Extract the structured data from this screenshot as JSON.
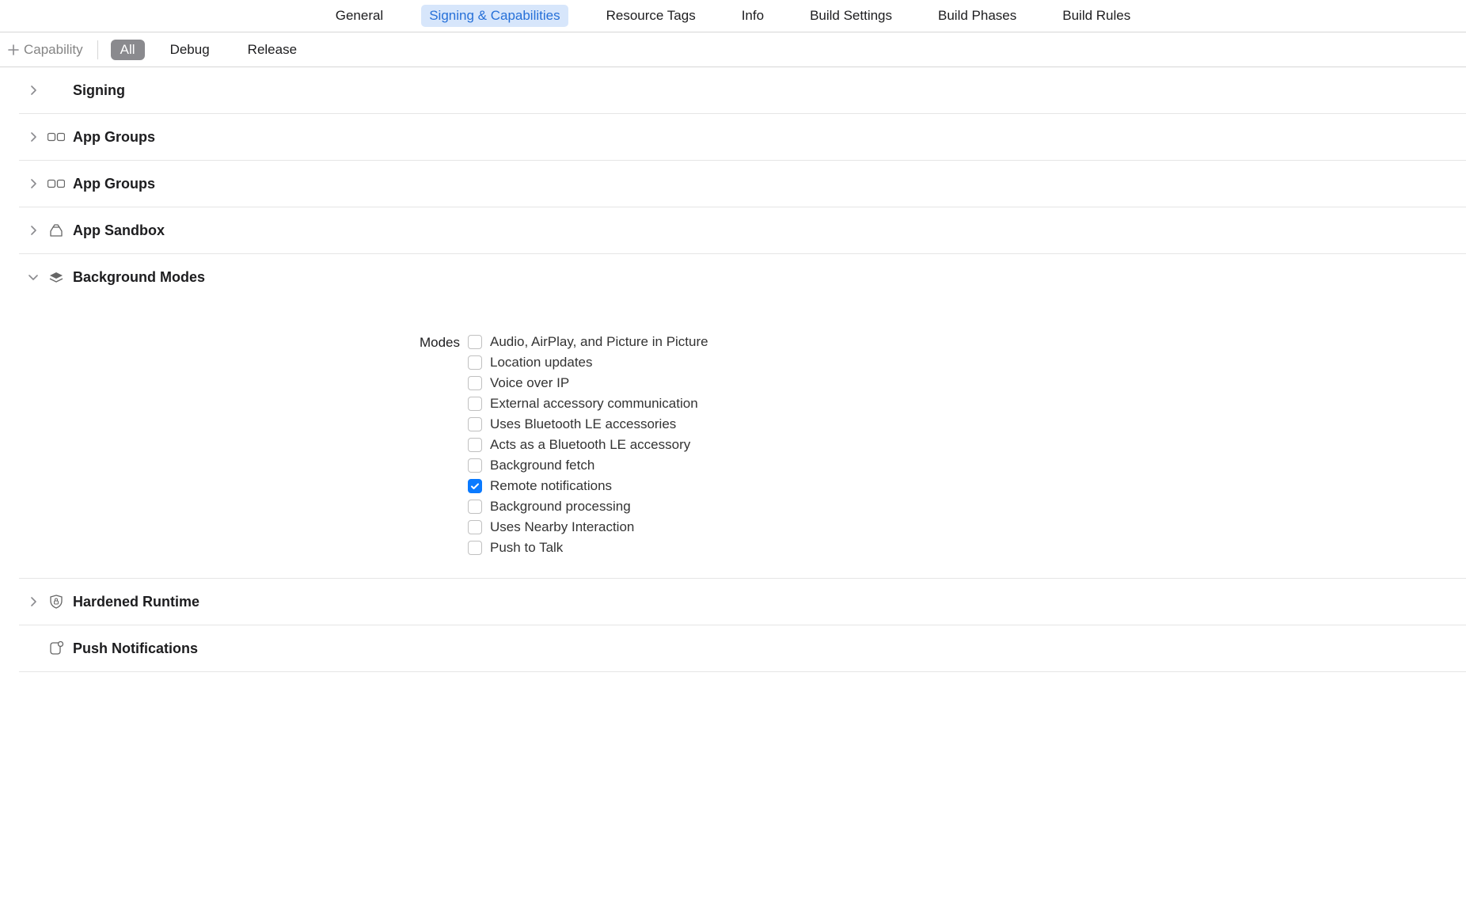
{
  "tabs": {
    "general": "General",
    "signing": "Signing & Capabilities",
    "resource_tags": "Resource Tags",
    "info": "Info",
    "build_settings": "Build Settings",
    "build_phases": "Build Phases",
    "build_rules": "Build Rules",
    "active": "signing"
  },
  "toolbar": {
    "add_capability": "Capability",
    "filters": {
      "all": "All",
      "debug": "Debug",
      "release": "Release"
    }
  },
  "sections": {
    "signing": "Signing",
    "app_groups_1": "App Groups",
    "app_groups_2": "App Groups",
    "app_sandbox": "App Sandbox",
    "background_modes": "Background Modes",
    "hardened_runtime": "Hardened Runtime",
    "push_notifications": "Push Notifications"
  },
  "background_modes": {
    "label": "Modes",
    "items": [
      {
        "label": "Audio, AirPlay, and Picture in Picture",
        "checked": false
      },
      {
        "label": "Location updates",
        "checked": false
      },
      {
        "label": "Voice over IP",
        "checked": false
      },
      {
        "label": "External accessory communication",
        "checked": false
      },
      {
        "label": "Uses Bluetooth LE accessories",
        "checked": false
      },
      {
        "label": "Acts as a Bluetooth LE accessory",
        "checked": false
      },
      {
        "label": "Background fetch",
        "checked": false
      },
      {
        "label": "Remote notifications",
        "checked": true
      },
      {
        "label": "Background processing",
        "checked": false
      },
      {
        "label": "Uses Nearby Interaction",
        "checked": false
      },
      {
        "label": "Push to Talk",
        "checked": false
      }
    ]
  }
}
